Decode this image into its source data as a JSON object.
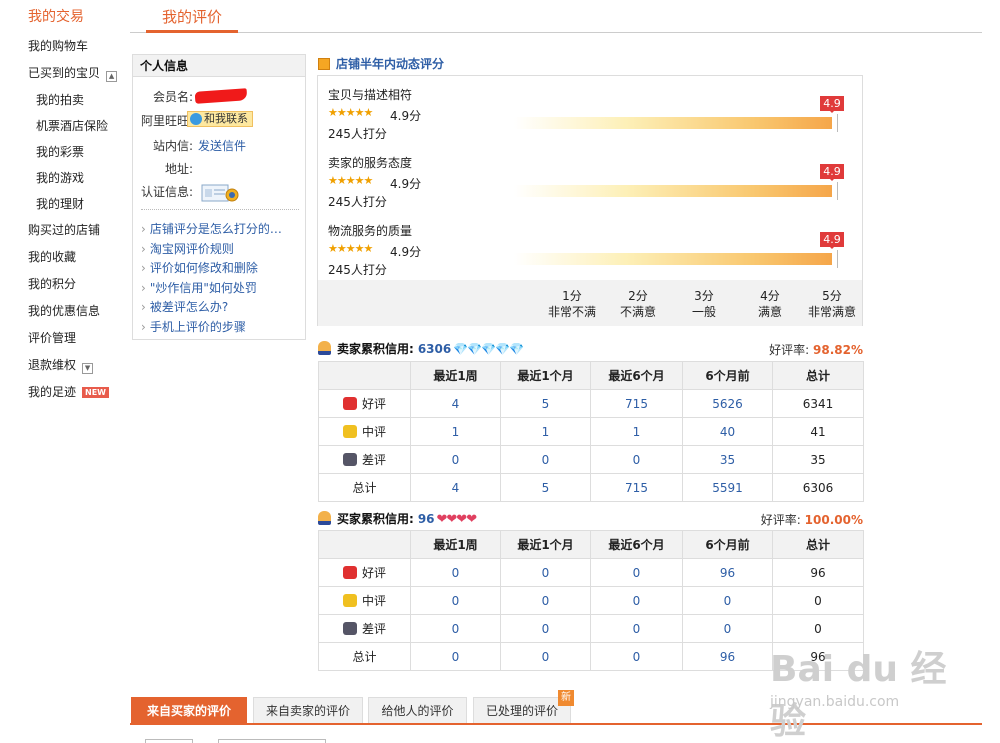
{
  "sidebar": {
    "title": "我的交易",
    "items": [
      {
        "label": "我的购物车"
      },
      {
        "label": "已买到的宝贝"
      },
      {
        "label": "我的拍卖"
      },
      {
        "label": "机票酒店保险"
      },
      {
        "label": "我的彩票"
      },
      {
        "label": "我的游戏"
      },
      {
        "label": "我的理财"
      },
      {
        "label": "购买过的店铺"
      },
      {
        "label": "我的收藏"
      },
      {
        "label": "我的积分"
      },
      {
        "label": "我的优惠信息"
      },
      {
        "label": "评价管理"
      },
      {
        "label": "退款维权"
      },
      {
        "label": "我的足迹",
        "badge": "NEW"
      }
    ]
  },
  "page_tab": "我的评价",
  "personal_info": {
    "title": "个人信息",
    "member_label": "会员名:",
    "wangwang_label": "阿里旺旺:",
    "wangwang_button": "和我联系",
    "message_label": "站内信:",
    "message_link": "发送信件",
    "address_label": "地址:",
    "cert_label": "认证信息:",
    "help_links": [
      "店铺评分是怎么打分的…",
      "淘宝网评价规则",
      "评价如何修改和删除",
      "\"炒作信用\"如何处罚",
      "被差评怎么办?",
      "手机上评价的步骤"
    ]
  },
  "shop_rating": {
    "title": "店铺半年内动态评分",
    "items": [
      {
        "name": "宝贝与描述相符",
        "stars": "★★★★★",
        "score": "4.9分",
        "count": "245人打分",
        "marker": "4.9",
        "value": 4.9
      },
      {
        "name": "卖家的服务态度",
        "stars": "★★★★★",
        "score": "4.9分",
        "count": "245人打分",
        "marker": "4.9",
        "value": 4.9
      },
      {
        "name": "物流服务的质量",
        "stars": "★★★★★",
        "score": "4.9分",
        "count": "245人打分",
        "marker": "4.9",
        "value": 4.9
      }
    ],
    "scale": [
      {
        "score": "1分",
        "desc": "非常不满"
      },
      {
        "score": "2分",
        "desc": "不满意"
      },
      {
        "score": "3分",
        "desc": "一般"
      },
      {
        "score": "4分",
        "desc": "满意"
      },
      {
        "score": "5分",
        "desc": "非常满意"
      }
    ]
  },
  "seller_credit": {
    "label": "卖家累积信用:",
    "value": "6306",
    "gems": "💎💎💎💎💎",
    "rate_label": "好评率:",
    "rate": "98.82%",
    "headers": [
      "",
      "最近1周",
      "最近1个月",
      "最近6个月",
      "6个月前",
      "总计"
    ],
    "rows": [
      {
        "label": "好评",
        "type": "good",
        "cells": [
          "4",
          "5",
          "715",
          "5626",
          "6341"
        ]
      },
      {
        "label": "中评",
        "type": "mid",
        "cells": [
          "1",
          "1",
          "1",
          "40",
          "41"
        ]
      },
      {
        "label": "差评",
        "type": "bad",
        "cells": [
          "0",
          "0",
          "0",
          "35",
          "35"
        ]
      },
      {
        "label": "总计",
        "type": "total",
        "cells": [
          "4",
          "5",
          "715",
          "5591",
          "6306"
        ]
      }
    ]
  },
  "buyer_credit": {
    "label": "买家累积信用:",
    "value": "96",
    "hearts": "❤❤❤❤",
    "rate_label": "好评率:",
    "rate": "100.00%",
    "headers": [
      "",
      "最近1周",
      "最近1个月",
      "最近6个月",
      "6个月前",
      "总计"
    ],
    "rows": [
      {
        "label": "好评",
        "type": "good",
        "cells": [
          "0",
          "0",
          "0",
          "96",
          "96"
        ]
      },
      {
        "label": "中评",
        "type": "mid",
        "cells": [
          "0",
          "0",
          "0",
          "0",
          "0"
        ]
      },
      {
        "label": "差评",
        "type": "bad",
        "cells": [
          "0",
          "0",
          "0",
          "0",
          "0"
        ]
      },
      {
        "label": "总计",
        "type": "total",
        "cells": [
          "0",
          "0",
          "0",
          "96",
          "96"
        ]
      }
    ]
  },
  "bottom_tabs": [
    {
      "label": "来自买家的评价",
      "active": true
    },
    {
      "label": "来自卖家的评价",
      "active": false
    },
    {
      "label": "给他人的评价",
      "active": false
    },
    {
      "label": "已处理的评价",
      "active": false,
      "badge": "新"
    }
  ],
  "watermark": {
    "logo": "Bai du 经验",
    "sub": "jingyan.baidu.com"
  },
  "colors": {
    "accent": "#e4632f",
    "link": "#2e5ea6",
    "marker": "#e03a3a"
  }
}
